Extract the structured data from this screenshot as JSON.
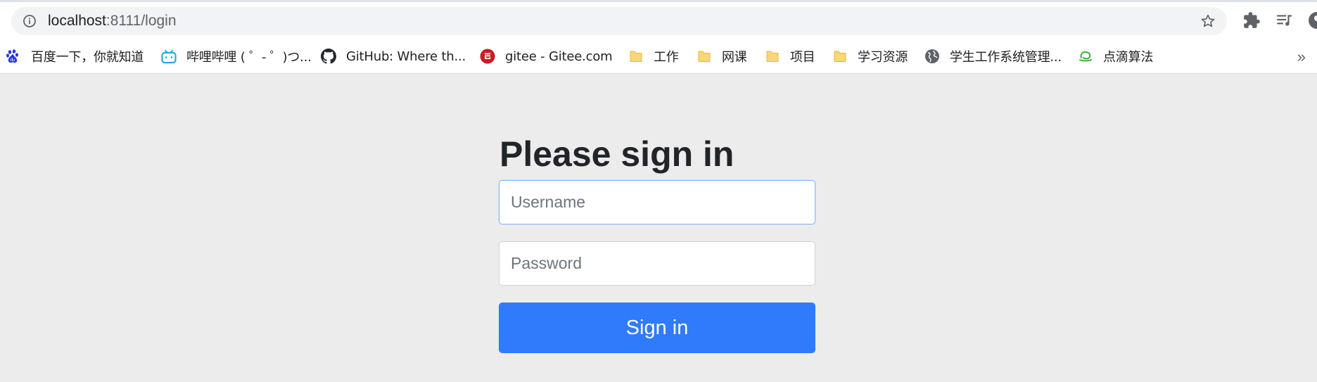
{
  "browser": {
    "url_host": "localhost",
    "url_rest": ":8111/login"
  },
  "bookmarks": [
    {
      "label": "百度一下，你就知道",
      "icon": "baidu-icon",
      "color": "#2932e1"
    },
    {
      "label": "哔哩哔哩 ( ゜- ゜)つ...",
      "icon": "bilibili-icon",
      "color": "#23ade5"
    },
    {
      "label": "GitHub: Where th...",
      "icon": "github-icon",
      "color": "#24292f"
    },
    {
      "label": "gitee - Gitee.com",
      "icon": "gitee-icon",
      "color": "#c71d23"
    },
    {
      "label": "工作",
      "icon": "folder-icon",
      "color": "#f8d775"
    },
    {
      "label": "网课",
      "icon": "folder-icon",
      "color": "#f8d775"
    },
    {
      "label": "项目",
      "icon": "folder-icon",
      "color": "#f8d775"
    },
    {
      "label": "学习资源",
      "icon": "folder-icon",
      "color": "#f8d775"
    },
    {
      "label": "学生工作系统管理...",
      "icon": "globe-icon",
      "color": "#5f6368"
    },
    {
      "label": "点滴算法",
      "icon": "leetcode-icon",
      "color": "#3cb043"
    }
  ],
  "bookmarks_overflow": "»",
  "login": {
    "title": "Please sign in",
    "username_placeholder": "Username",
    "password_placeholder": "Password",
    "submit_label": "Sign in"
  },
  "colors": {
    "primary": "#307bfc",
    "page_bg": "#ececec"
  }
}
